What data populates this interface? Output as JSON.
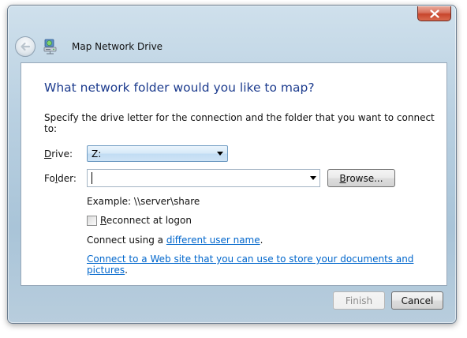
{
  "window": {
    "title": "Map Network Drive"
  },
  "icons": {
    "close": "close-icon",
    "back": "back-arrow-icon",
    "network": "network-drive-icon"
  },
  "content": {
    "heading": "What network folder would you like to map?",
    "instruction": "Specify the drive letter for the connection and the folder that you want to connect to:",
    "drive": {
      "label_prefix": "D",
      "label_rest": "rive:",
      "value": "Z:"
    },
    "folder": {
      "label_prefix": "Fo",
      "label_underlined": "l",
      "label_rest": "der:",
      "value": ""
    },
    "browse_button": {
      "underlined": "B",
      "rest": "rowse..."
    },
    "example": "Example: \\\\server\\share",
    "reconnect": {
      "underlined": "R",
      "rest": "econnect at logon",
      "checked": false
    },
    "connect_using": {
      "prefix": "Connect using a ",
      "link": "different user name",
      "suffix": "."
    },
    "web_link": {
      "link": "Connect to a Web site that you can use to store your documents and pictures",
      "suffix": "."
    }
  },
  "footer": {
    "finish_label": "Finish",
    "cancel_label": "Cancel"
  },
  "colors": {
    "heading": "#1d3c8e",
    "link": "#0066cc",
    "close_button": "#c8452c"
  }
}
